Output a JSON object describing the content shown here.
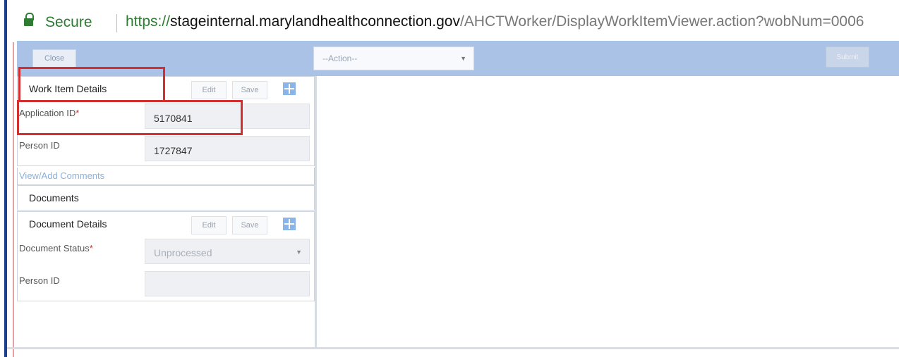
{
  "browser": {
    "secure_label": "Secure",
    "url_scheme": "https://",
    "url_host": "stageinternal.marylandhealthconnection.gov",
    "url_path": "/AHCTWorker/DisplayWorkItemViewer.action?wobNum=0006"
  },
  "toolbar": {
    "close_label": "Close",
    "action_select_value": "--Action--",
    "submit_label": "Submit"
  },
  "work_item": {
    "title": "Work Item Details",
    "edit_label": "Edit",
    "save_label": "Save",
    "fields": [
      {
        "label": "Application ID",
        "required_mark": "*",
        "value": "5170841"
      },
      {
        "label": "Person ID",
        "value": "1727847"
      }
    ],
    "comments_link": "View/Add Comments"
  },
  "documents": {
    "title": "Documents"
  },
  "document_details": {
    "title": "Document Details",
    "edit_label": "Edit",
    "save_label": "Save",
    "status_label": "Document Status",
    "status_required_mark": "*",
    "status_value": "Unprocessed",
    "person_id_label": "Person ID",
    "person_id_value": ""
  },
  "colors": {
    "toolbar_bg": "#a9c2e6",
    "highlight": "#d32f2f",
    "secure_green": "#2e7d32"
  }
}
